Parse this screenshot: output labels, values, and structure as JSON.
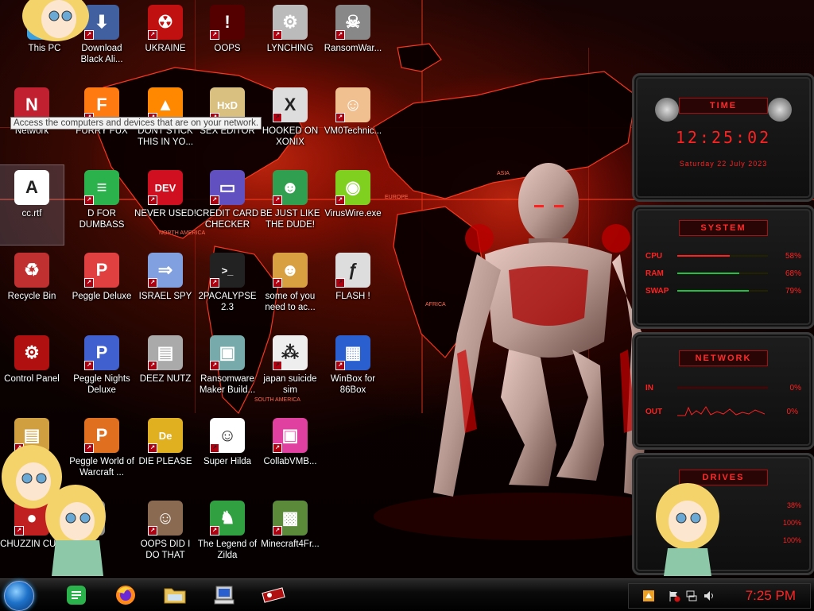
{
  "desktop": {
    "tooltip": "Access the computers and devices that are on your network.",
    "icons": [
      {
        "label": "This PC"
      },
      {
        "label": "Download Black Ali..."
      },
      {
        "label": "UKRAINE"
      },
      {
        "label": "OOPS"
      },
      {
        "label": "LYNCHING"
      },
      {
        "label": "RansomWar..."
      },
      {
        "label": "Network"
      },
      {
        "label": "FURRY FUX"
      },
      {
        "label": "DONT STICK THIS IN YO..."
      },
      {
        "label": "SEX EDITOR"
      },
      {
        "label": "HOOKED ON XONIX"
      },
      {
        "label": "VM0Technic..."
      },
      {
        "label": "cc.rtf"
      },
      {
        "label": "D FOR DUMBASS"
      },
      {
        "label": "NEVER USED!"
      },
      {
        "label": "CREDIT CARD CHECKER"
      },
      {
        "label": "BE JUST LIKE THE DUDE!"
      },
      {
        "label": "VirusWire.exe"
      },
      {
        "label": "Recycle Bin"
      },
      {
        "label": "Peggle Deluxe"
      },
      {
        "label": "ISRAEL SPY"
      },
      {
        "label": "2PACALYPSE 2.3"
      },
      {
        "label": "some of you need to ac..."
      },
      {
        "label": "FLASH !"
      },
      {
        "label": "Control Panel"
      },
      {
        "label": "Peggle Nights Deluxe"
      },
      {
        "label": "DEEZ NUTZ"
      },
      {
        "label": "Ransomware Maker Build..."
      },
      {
        "label": "japan suicide sim"
      },
      {
        "label": "WinBox for 86Box"
      },
      {
        "label": "...ISTS ...G"
      },
      {
        "label": "Peggle World of Warcraft ..."
      },
      {
        "label": "DIE PLEASE"
      },
      {
        "label": "Super Hilda"
      },
      {
        "label": "CollabVMB..."
      },
      {
        "label": "CHUZZIN CUM"
      },
      {
        "label": "...es"
      },
      {
        "label": "OOPS DID I DO THAT"
      },
      {
        "label": "The Legend of Zilda"
      },
      {
        "label": "Minecraft4Fr..."
      }
    ]
  },
  "map_labels": {
    "north_america": "NORTH AMERICA",
    "south_america": "SOUTH AMERICA",
    "europe": "EUROPE",
    "africa": "AFRICA",
    "asia": "ASIA"
  },
  "widgets": {
    "time": {
      "title": "TIME",
      "time": "12:25:02",
      "date": "Saturday 22 July 2023"
    },
    "system": {
      "title": "SYSTEM",
      "rows": [
        {
          "key": "CPU",
          "value": "58%",
          "fill": 0.58
        },
        {
          "key": "RAM",
          "value": "68%",
          "fill": 0.68
        },
        {
          "key": "SWAP",
          "value": "79%",
          "fill": 0.79
        }
      ]
    },
    "network": {
      "title": "NETWORK",
      "rows": [
        {
          "key": "IN",
          "value": "0%"
        },
        {
          "key": "OUT",
          "value": "0%"
        }
      ]
    },
    "drives": {
      "title": "DRIVES",
      "rows": [
        {
          "value": "38%"
        },
        {
          "value": "100%"
        },
        {
          "value": "100%"
        }
      ]
    }
  },
  "taskbar": {
    "pinned": [
      "feedly-icon",
      "firefox-icon",
      "file-explorer-icon",
      "winbox-icon",
      "control-panel-icon"
    ],
    "clock": "7:25 PM"
  },
  "colors": {
    "accent_red": "#ff2424",
    "widget_frame": "#3a3a3a",
    "taskbar": "#0b0b0b"
  }
}
